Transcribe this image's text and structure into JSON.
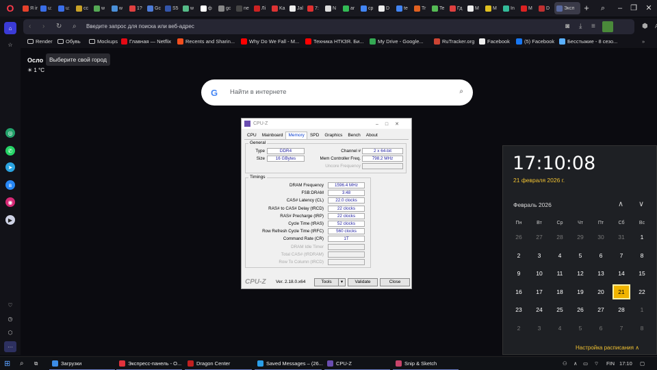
{
  "browser": {
    "tabs": [
      {
        "label": "Я in",
        "color": "#e6412b"
      },
      {
        "label": "u:",
        "color": "#3a6ee8"
      },
      {
        "label": "u:",
        "color": "#3a6ee8"
      },
      {
        "label": "cc",
        "color": "#c9a227"
      },
      {
        "label": "w",
        "color": "#55aa55"
      },
      {
        "label": "w",
        "color": "#4a90d9"
      },
      {
        "label": "1?",
        "color": "#e04040"
      },
      {
        "label": "Gc",
        "color": "#4d7bd6"
      },
      {
        "label": "S5",
        "color": "#3355aa"
      },
      {
        "label": "w",
        "color": "#5b8"
      },
      {
        "label": "ф",
        "color": "#fff"
      },
      {
        "label": "gc",
        "color": "#888"
      },
      {
        "label": "ne",
        "color": "#444"
      },
      {
        "label": "Лі",
        "color": "#cc2222"
      },
      {
        "label": "Ka",
        "color": "#dd3333"
      },
      {
        "label": "Jal",
        "color": "#eee"
      },
      {
        "label": "7:",
        "color": "#e03030"
      },
      {
        "label": "N",
        "color": "#ddd"
      },
      {
        "label": "ar",
        "color": "#3b5"
      },
      {
        "label": "cp",
        "color": "#4285f4"
      },
      {
        "label": "D",
        "color": "#eee"
      },
      {
        "label": "te",
        "color": "#4285f4"
      },
      {
        "label": "Tr",
        "color": "#e06020"
      },
      {
        "label": "Te",
        "color": "#55bb55"
      },
      {
        "label": "Гд",
        "color": "#e04040"
      },
      {
        "label": "M",
        "color": "#eee"
      },
      {
        "label": "M",
        "color": "#e0c020"
      },
      {
        "label": "In",
        "color": "#3b9"
      },
      {
        "label": "M",
        "color": "#dd2222"
      },
      {
        "label": "D",
        "color": "#c03030"
      },
      {
        "label": "Эксп",
        "color": "#5a6aa0",
        "active": true
      }
    ],
    "address_placeholder": "Введите запрос для поиска или веб-адрес",
    "ai_label": "AI",
    "bookmarks": [
      {
        "label": "Render",
        "icon": "folder-icon"
      },
      {
        "label": "Обувь",
        "icon": "folder-icon"
      },
      {
        "label": "Mockups",
        "icon": "folder-icon"
      },
      {
        "label": "Главная — Netflix",
        "icon": "netflix-icon"
      },
      {
        "label": "Recents and Sharin...",
        "icon": "figma-icon"
      },
      {
        "label": "Why Do We Fall - M...",
        "icon": "youtube-icon"
      },
      {
        "label": "Техника НТКЗЯ. Би...",
        "icon": "youtube-icon"
      },
      {
        "label": "My Drive - Google...",
        "icon": "drive-icon"
      },
      {
        "label": "RuTracker.org",
        "icon": "rutracker-icon"
      },
      {
        "label": "Facebook",
        "icon": "page-icon"
      },
      {
        "label": "(5) Facebook",
        "icon": "facebook-icon"
      },
      {
        "label": "Бесстыжие - 8 сезо...",
        "icon": "sh-icon"
      }
    ]
  },
  "weather": {
    "city": "Осло",
    "tooltip": "Выберите свой город",
    "temp": "1 °C"
  },
  "search": {
    "placeholder": "Найти в интернете"
  },
  "cpuz": {
    "title": "CPU-Z",
    "tabs": [
      "CPU",
      "Mainboard",
      "Memory",
      "SPD",
      "Graphics",
      "Bench",
      "About"
    ],
    "general_title": "General",
    "type_label": "Type",
    "type_value": "DDR4",
    "size_label": "Size",
    "size_value": "16 GBytes",
    "channel_label": "Channel #",
    "channel_value": "2 x 64-bit",
    "mcf_label": "Mem Controller Freq.",
    "mcf_value": "798.2 MHz",
    "uncore_label": "Uncore Frequency",
    "timings_title": "Timings",
    "timings": [
      {
        "label": "DRAM Frequency",
        "value": "1596.4 MHz",
        "dim": false
      },
      {
        "label": "FSB:DRAM",
        "value": "3:48",
        "dim": false
      },
      {
        "label": "CAS# Latency (CL)",
        "value": "22.0 clocks",
        "dim": false
      },
      {
        "label": "RAS# to CAS# Delay (tRCD)",
        "value": "22 clocks",
        "dim": false
      },
      {
        "label": "RAS# Precharge (tRP)",
        "value": "22 clocks",
        "dim": false
      },
      {
        "label": "Cycle Time (tRAS)",
        "value": "52 clocks",
        "dim": false
      },
      {
        "label": "Row Refresh Cycle Time (tRFC)",
        "value": "560 clocks",
        "dim": false
      },
      {
        "label": "Command Rate (CR)",
        "value": "1T",
        "dim": false
      },
      {
        "label": "DRAM Idle Timer",
        "value": "",
        "dim": true
      },
      {
        "label": "Total CAS# (tRDRAM)",
        "value": "",
        "dim": true
      },
      {
        "label": "Row To Column (tRCD)",
        "value": "",
        "dim": true
      }
    ],
    "logo": "CPU-Z",
    "version": "Ver. 2.18.0.x64",
    "tools_label": "Tools",
    "validate_label": "Validate",
    "close_label": "Close"
  },
  "clock": {
    "time": "17:10:08",
    "date": "21 февраля 2026 г.",
    "month": "Февраль 2026",
    "weekdays": [
      "Пн",
      "Вт",
      "Ср",
      "Чт",
      "Пт",
      "Сб",
      "Вс"
    ],
    "days": [
      [
        "26",
        "27",
        "28",
        "29",
        "30",
        "31",
        "1"
      ],
      [
        "2",
        "3",
        "4",
        "5",
        "6",
        "7",
        "8"
      ],
      [
        "9",
        "10",
        "11",
        "12",
        "13",
        "14",
        "15"
      ],
      [
        "16",
        "17",
        "18",
        "19",
        "20",
        "21",
        "22"
      ],
      [
        "23",
        "24",
        "25",
        "26",
        "27",
        "28",
        "1"
      ],
      [
        "2",
        "3",
        "4",
        "5",
        "6",
        "7",
        "8"
      ]
    ],
    "today": "21",
    "schedule_label": "Настройка расписания"
  },
  "taskbar": {
    "items": [
      {
        "label": "Загрузки",
        "color": "#3c8ce7"
      },
      {
        "label": "Экспресс-панель - О...",
        "color": "#e0323c"
      },
      {
        "label": "Dragon Center",
        "color": "#c02020"
      },
      {
        "label": "Saved Messages – (26...",
        "color": "#2a9ee8"
      },
      {
        "label": "CPU-Z",
        "color": "#6a4db0"
      },
      {
        "label": "Snip & Sketch",
        "color": "#c7446a"
      }
    ],
    "lang": "FIN",
    "time": "17:10"
  }
}
